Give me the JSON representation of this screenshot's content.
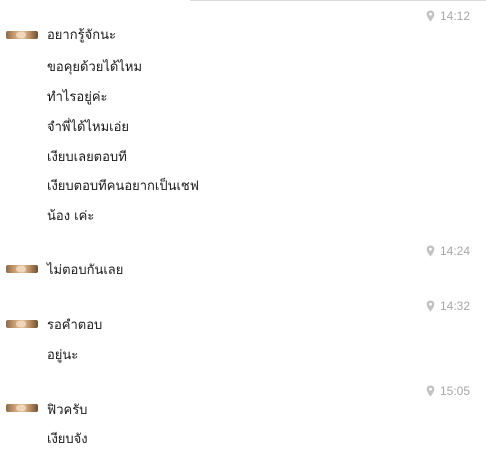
{
  "conversation": {
    "groups": [
      {
        "time": "14:12",
        "messages": [
          "อยากรู้จักนะ",
          "ขอคุยด้วยได้ไหม",
          "ทำไรอยู่ค่ะ",
          "จำพี่ได้ไหมเอ่ย",
          "เงียบเลยตอบที",
          "เงียบตอบทีคนอยากเป็นเชฟ",
          "น้อง   เค่ะ"
        ]
      },
      {
        "time": "14:24",
        "messages": [
          "ไม่ตอบกันเลย"
        ]
      },
      {
        "time": "14:32",
        "messages": [
          "รอคำตอบ",
          "อยู่นะ"
        ]
      },
      {
        "time": "15:05",
        "messages": [
          "ฟิวครับ",
          "เงียบจัง"
        ]
      }
    ]
  },
  "colors": {
    "timestamp": "#a8a8a8",
    "text": "#1a1a1a",
    "divider": "#dcdcdc"
  },
  "icons": {
    "time_marker": "location-pin-icon"
  }
}
